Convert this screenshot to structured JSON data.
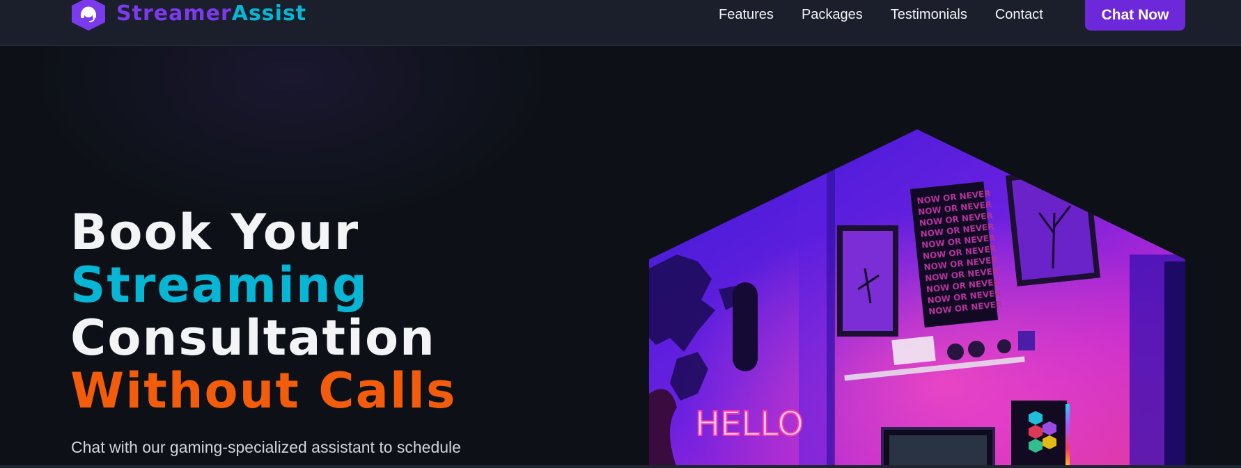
{
  "brand": {
    "name_part1": "Streamer",
    "name_part2": "Assist",
    "icon": "headset-icon",
    "colors": {
      "primary": "#7c3aed",
      "secondary": "#06b6d4"
    }
  },
  "nav": {
    "links": [
      {
        "label": "Features"
      },
      {
        "label": "Packages"
      },
      {
        "label": "Testimonials"
      },
      {
        "label": "Contact"
      }
    ],
    "cta_label": "Chat Now"
  },
  "hero": {
    "title": {
      "line1": "Book Your",
      "line2": "Streaming",
      "line3": "Consultation",
      "line4": "Without Calls"
    },
    "subtitle": "Chat with our gaming-specialized assistant to schedule",
    "image": {
      "neon_sign": "HELLO",
      "poster_text": "NOW OR NEVER"
    },
    "colors": {
      "accent_cyan": "#06b6d4",
      "accent_orange": "#f25c0a",
      "accent_purple": "#6d28d9"
    }
  }
}
